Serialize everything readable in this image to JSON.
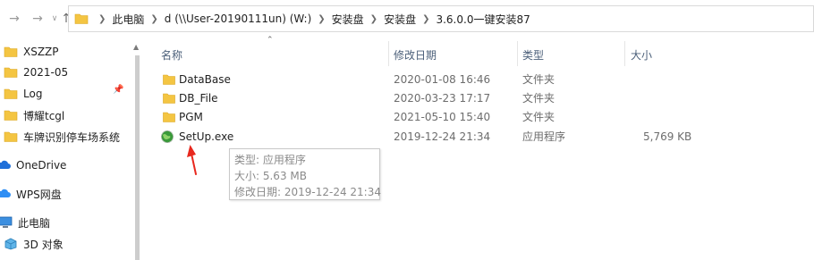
{
  "nav": {
    "back_icon": "arrow-left-icon",
    "forward_icon": "arrow-right-icon",
    "recent_icon": "chevron-down-icon",
    "up_icon": "arrow-up-icon"
  },
  "address": {
    "crumbs": [
      "此电脑",
      "d (\\\\User-20190111un) (W:)",
      "安装盘",
      "安装盘",
      "3.6.0.0一键安装87"
    ]
  },
  "sidebar": {
    "items": [
      {
        "label": "XSZZP",
        "icon": "folder-icon"
      },
      {
        "label": "2021-05",
        "icon": "folder-icon"
      },
      {
        "label": "Log",
        "icon": "folder-icon"
      },
      {
        "label": "博耀tcgl",
        "icon": "folder-icon"
      },
      {
        "label": "车牌识别停车场系统",
        "icon": "folder-icon"
      },
      {
        "label": "OneDrive",
        "icon": "cloud-icon"
      },
      {
        "label": "WPS网盘",
        "icon": "cloud-icon"
      },
      {
        "label": "此电脑",
        "icon": "computer-icon"
      },
      {
        "label": "3D 对象",
        "icon": "cube-icon"
      }
    ]
  },
  "columns": {
    "name": "名称",
    "modified": "修改日期",
    "type": "类型",
    "size": "大小"
  },
  "files": [
    {
      "name": "DataBase",
      "modified": "2020-01-08 16:46",
      "type": "文件夹",
      "size": "",
      "icon": "folder-icon"
    },
    {
      "name": "DB_File",
      "modified": "2020-03-23 17:17",
      "type": "文件夹",
      "size": "",
      "icon": "folder-icon"
    },
    {
      "name": "PGM",
      "modified": "2021-05-10 15:40",
      "type": "文件夹",
      "size": "",
      "icon": "folder-icon"
    },
    {
      "name": "SetUp.exe",
      "modified": "2019-12-24 21:34",
      "type": "应用程序",
      "size": "5,769 KB",
      "icon": "setup-globe-icon"
    }
  ],
  "tooltip": {
    "line1": "类型: 应用程序",
    "line2": "大小: 5.63 MB",
    "line3": "修改日期: 2019-12-24 21:34"
  },
  "colors": {
    "folder": "#f4c542",
    "header_text": "#4c607a",
    "annotation_arrow": "#e8281e"
  }
}
